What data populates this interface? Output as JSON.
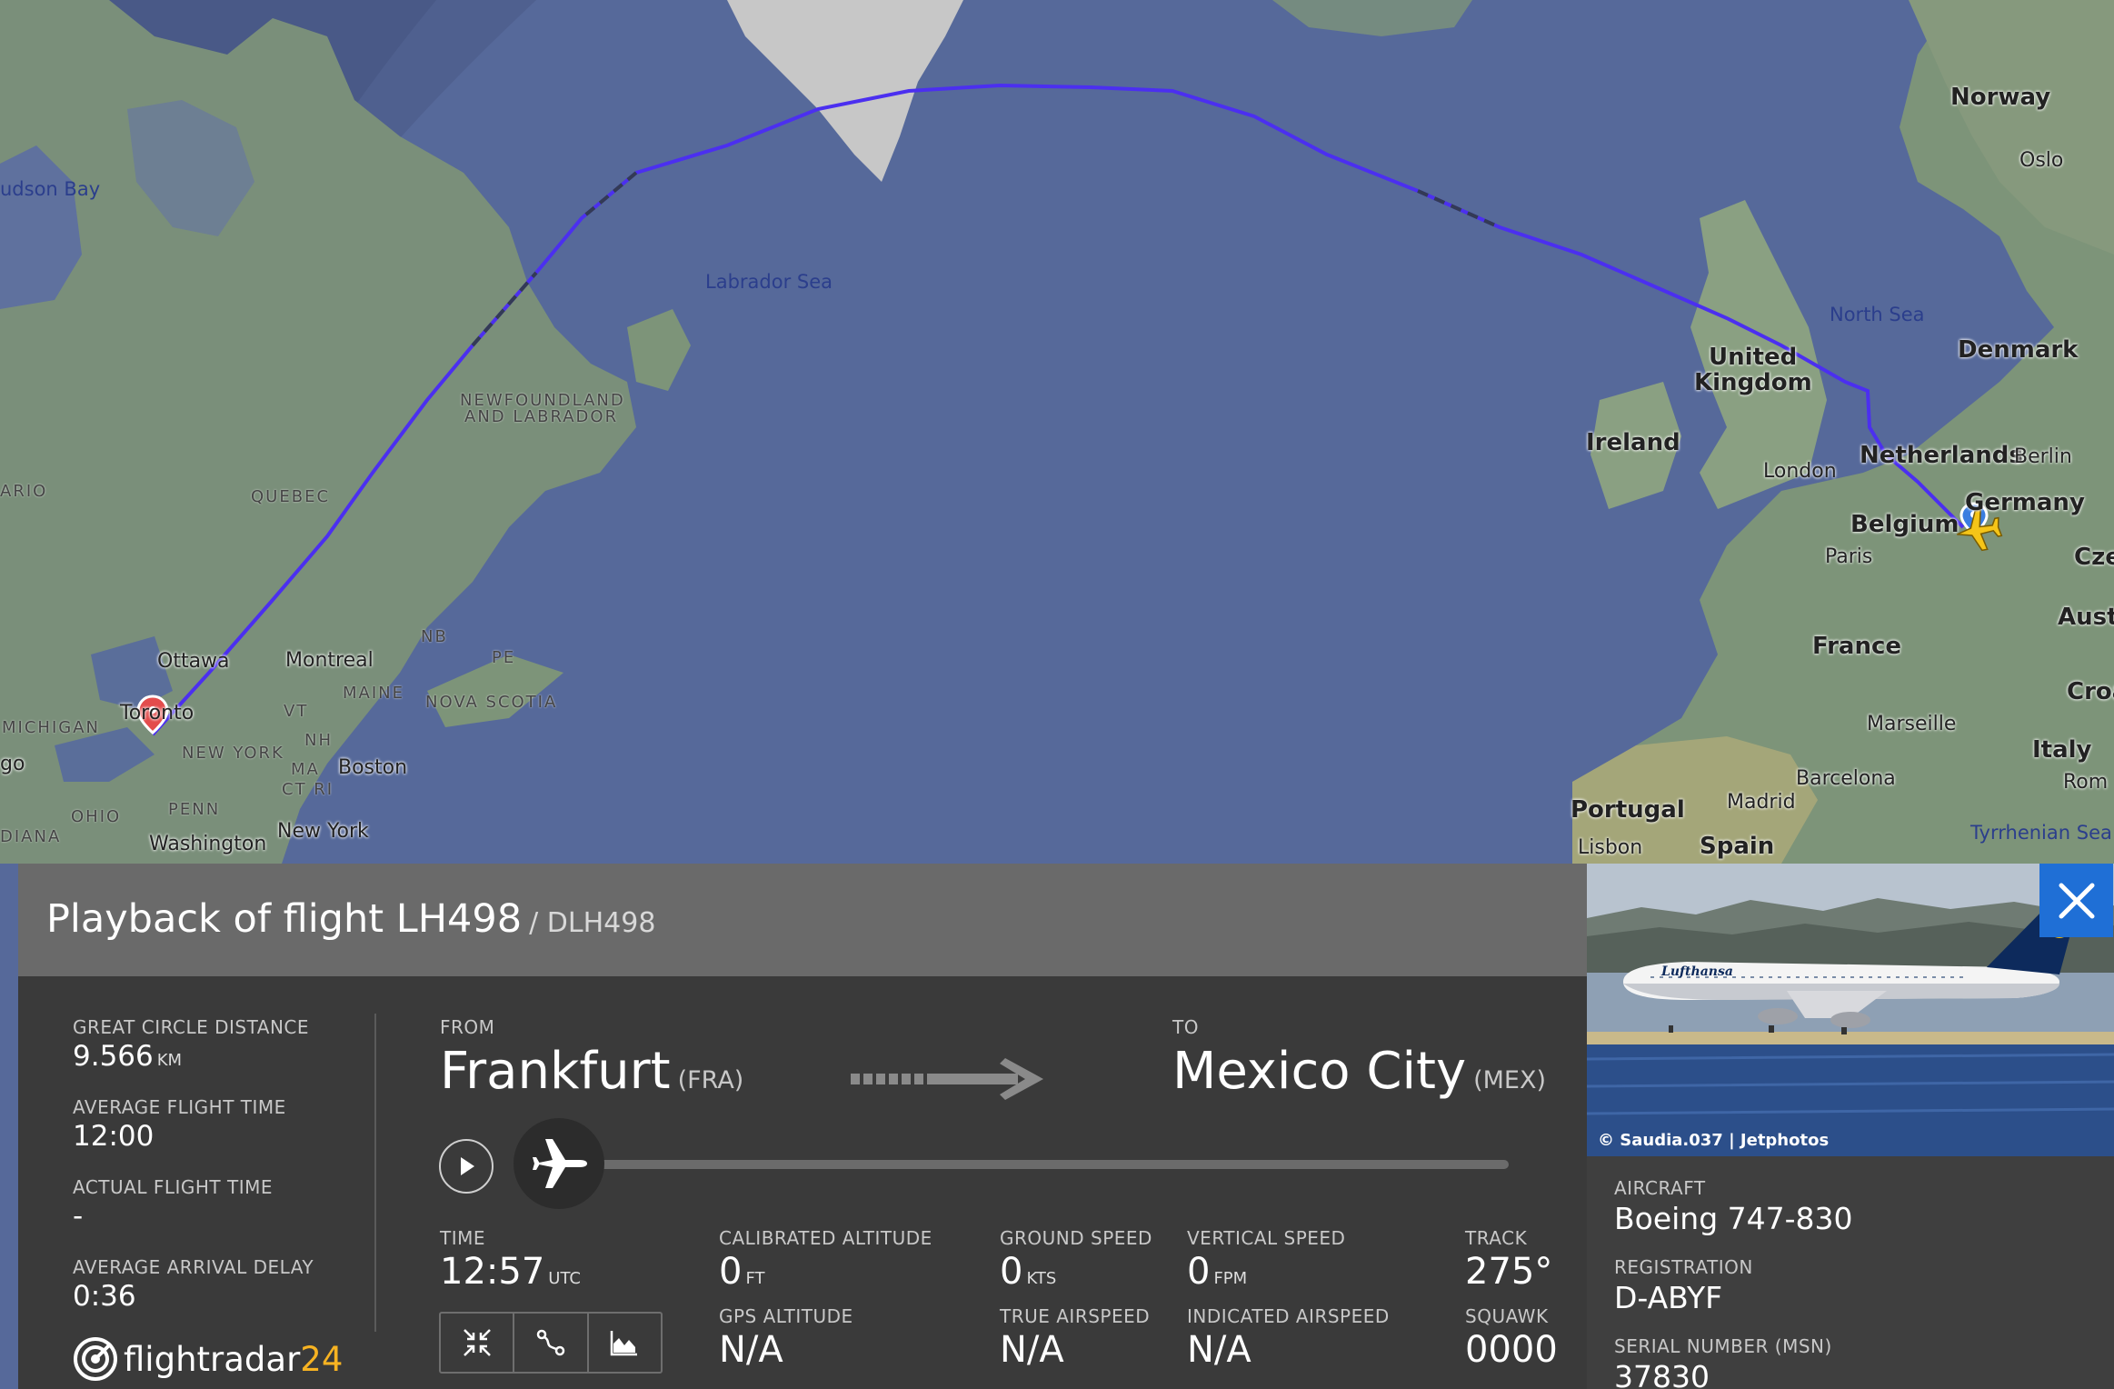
{
  "map": {
    "labels": {
      "hudson_bay": "udson Bay",
      "labrador_sea": "Labrador Sea",
      "north_sea": "North Sea",
      "tyrrhenian_sea": "Tyrrhenian Sea",
      "newfoundland_1": "NEWFOUNDLAND",
      "newfoundland_2": "AND LABRADOR",
      "quebec": "QUEBEC",
      "ontario": "ARIO",
      "michigan": "MICHIGAN",
      "ohio": "OHIO",
      "indiana": "DIANA",
      "penn": "PENN",
      "new_york_state": "NEW YORK",
      "maine": "MAINE",
      "vt": "VT",
      "nh": "NH",
      "ma": "MA",
      "ct_ri": "CT RI",
      "nb": "NB",
      "pe": "PE",
      "nova_scotia": "NOVA SCOTIA",
      "chicago": "go",
      "ottawa": "Ottawa",
      "montreal": "Montreal",
      "toronto": "Toronto",
      "boston": "Boston",
      "new_york": "New York",
      "washington": "Washington",
      "norway": "Norway",
      "oslo": "Oslo",
      "denmark": "Denmark",
      "uk_1": "United",
      "uk_2": "Kingdom",
      "ireland": "Ireland",
      "london": "London",
      "netherlands": "Netherlands",
      "berlin": "Berlin",
      "germany": "Germany",
      "belgium": "Belgium",
      "paris": "Paris",
      "czech": "Cze",
      "austria": "Austr",
      "croatia": "Croa",
      "france": "France",
      "marseille": "Marseille",
      "italy": "Italy",
      "rome": "Rom",
      "barcelona": "Barcelona",
      "portugal": "Portugal",
      "madrid": "Madrid",
      "lisbon": "Lisbon",
      "spain": "Spain"
    },
    "route_color": "#4b2ff0"
  },
  "panel": {
    "title": "Playback of flight LH498",
    "callsign": "/ DLH498",
    "great_circle_label": "GREAT CIRCLE DISTANCE",
    "great_circle_value": "9.566",
    "great_circle_unit": "KM",
    "avg_flight_time_label": "AVERAGE FLIGHT TIME",
    "avg_flight_time_value": "12:00",
    "actual_flight_time_label": "ACTUAL FLIGHT TIME",
    "actual_flight_time_value": "-",
    "avg_arrival_delay_label": "AVERAGE ARRIVAL DELAY",
    "avg_arrival_delay_value": "0:36",
    "from_label": "FROM",
    "from_city": "Frankfurt",
    "from_code": "(FRA)",
    "to_label": "TO",
    "to_city": "Mexico City",
    "to_code": "(MEX)",
    "playback_progress": 0.0,
    "time_label": "TIME",
    "time_value": "12:57",
    "time_unit": "UTC",
    "cal_alt_label": "CALIBRATED ALTITUDE",
    "cal_alt_value": "0",
    "cal_alt_unit": "FT",
    "gps_alt_label": "GPS ALTITUDE",
    "gps_alt_value": "N/A",
    "ground_speed_label": "GROUND SPEED",
    "ground_speed_value": "0",
    "ground_speed_unit": "KTS",
    "true_airspeed_label": "TRUE AIRSPEED",
    "true_airspeed_value": "N/A",
    "vert_speed_label": "VERTICAL SPEED",
    "vert_speed_value": "0",
    "vert_speed_unit": "FPM",
    "ind_airspeed_label": "INDICATED AIRSPEED",
    "ind_airspeed_value": "N/A",
    "track_label": "TRACK",
    "track_value": "275°",
    "squawk_label": "SQUAWK",
    "squawk_value": "0000",
    "logo_word": "flightradar",
    "logo_num": "24"
  },
  "aircraft": {
    "photo_credit": "© Saudia.037 | Jetphotos",
    "livery_text": "Lufthansa",
    "aircraft_label": "AIRCRAFT",
    "aircraft_value": "Boeing 747-830",
    "registration_label": "REGISTRATION",
    "registration_value": "D-ABYF",
    "serial_label": "SERIAL NUMBER (MSN)",
    "serial_value": "37830"
  },
  "colors": {
    "accent": "#1f6fd6",
    "logo_yellow": "#f7b322",
    "panel_bg": "#3a3a3a",
    "header_bg": "#6a6a6a"
  }
}
